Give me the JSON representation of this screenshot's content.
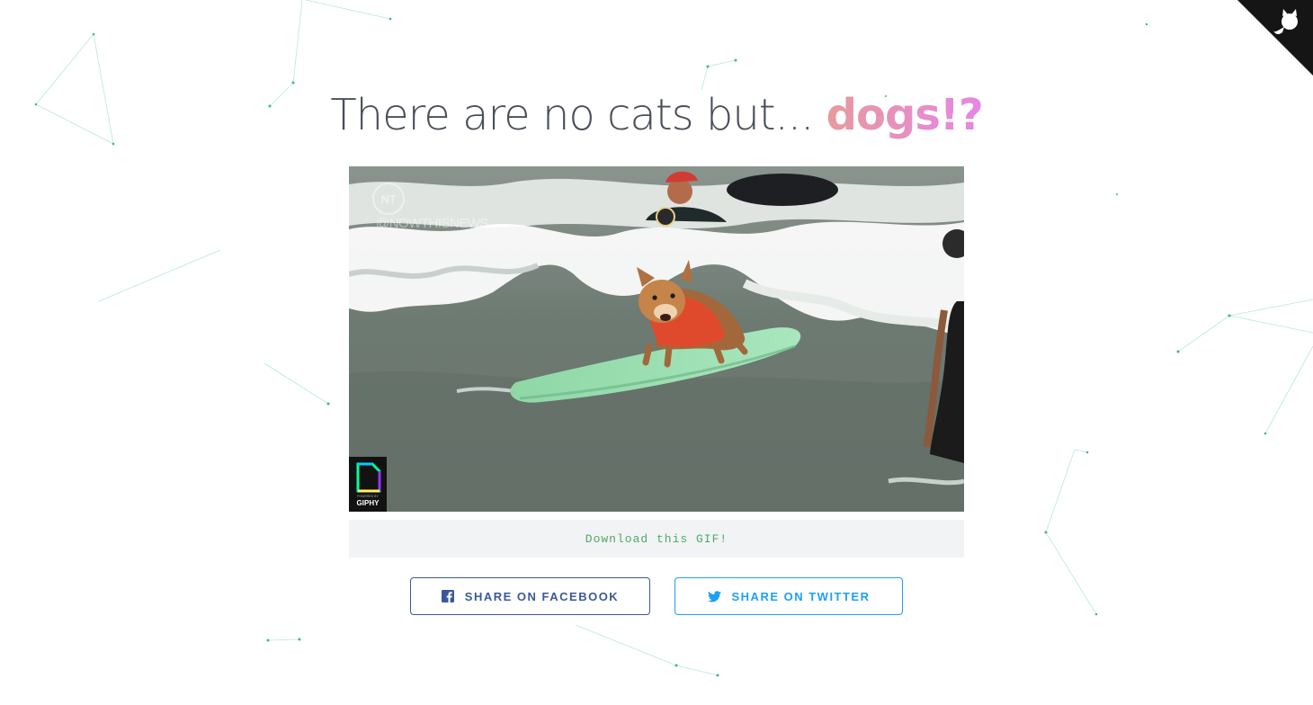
{
  "heading": {
    "prefix": "There are no cats but... ",
    "highlight": "dogs!?"
  },
  "gif": {
    "watermark_logo": "NT",
    "watermark_handle": "@NOWTHISNEWS",
    "badge_caption": "POWERED BY",
    "badge_label": "GIPHY"
  },
  "download_label": "Download this GIF!",
  "share": {
    "facebook_label": "SHARE ON FACEBOOK",
    "facebook_icon": "facebook-icon",
    "facebook_color": "#3b5998",
    "twitter_label": "SHARE ON TWITTER",
    "twitter_icon": "twitter-icon",
    "twitter_color": "#1da1f2"
  },
  "corner_icon": "github-octocat-icon",
  "colors": {
    "download_text": "#4fa86a",
    "dogs_gradient_start": "#e79b9b",
    "dogs_gradient_end": "#e686e6"
  }
}
